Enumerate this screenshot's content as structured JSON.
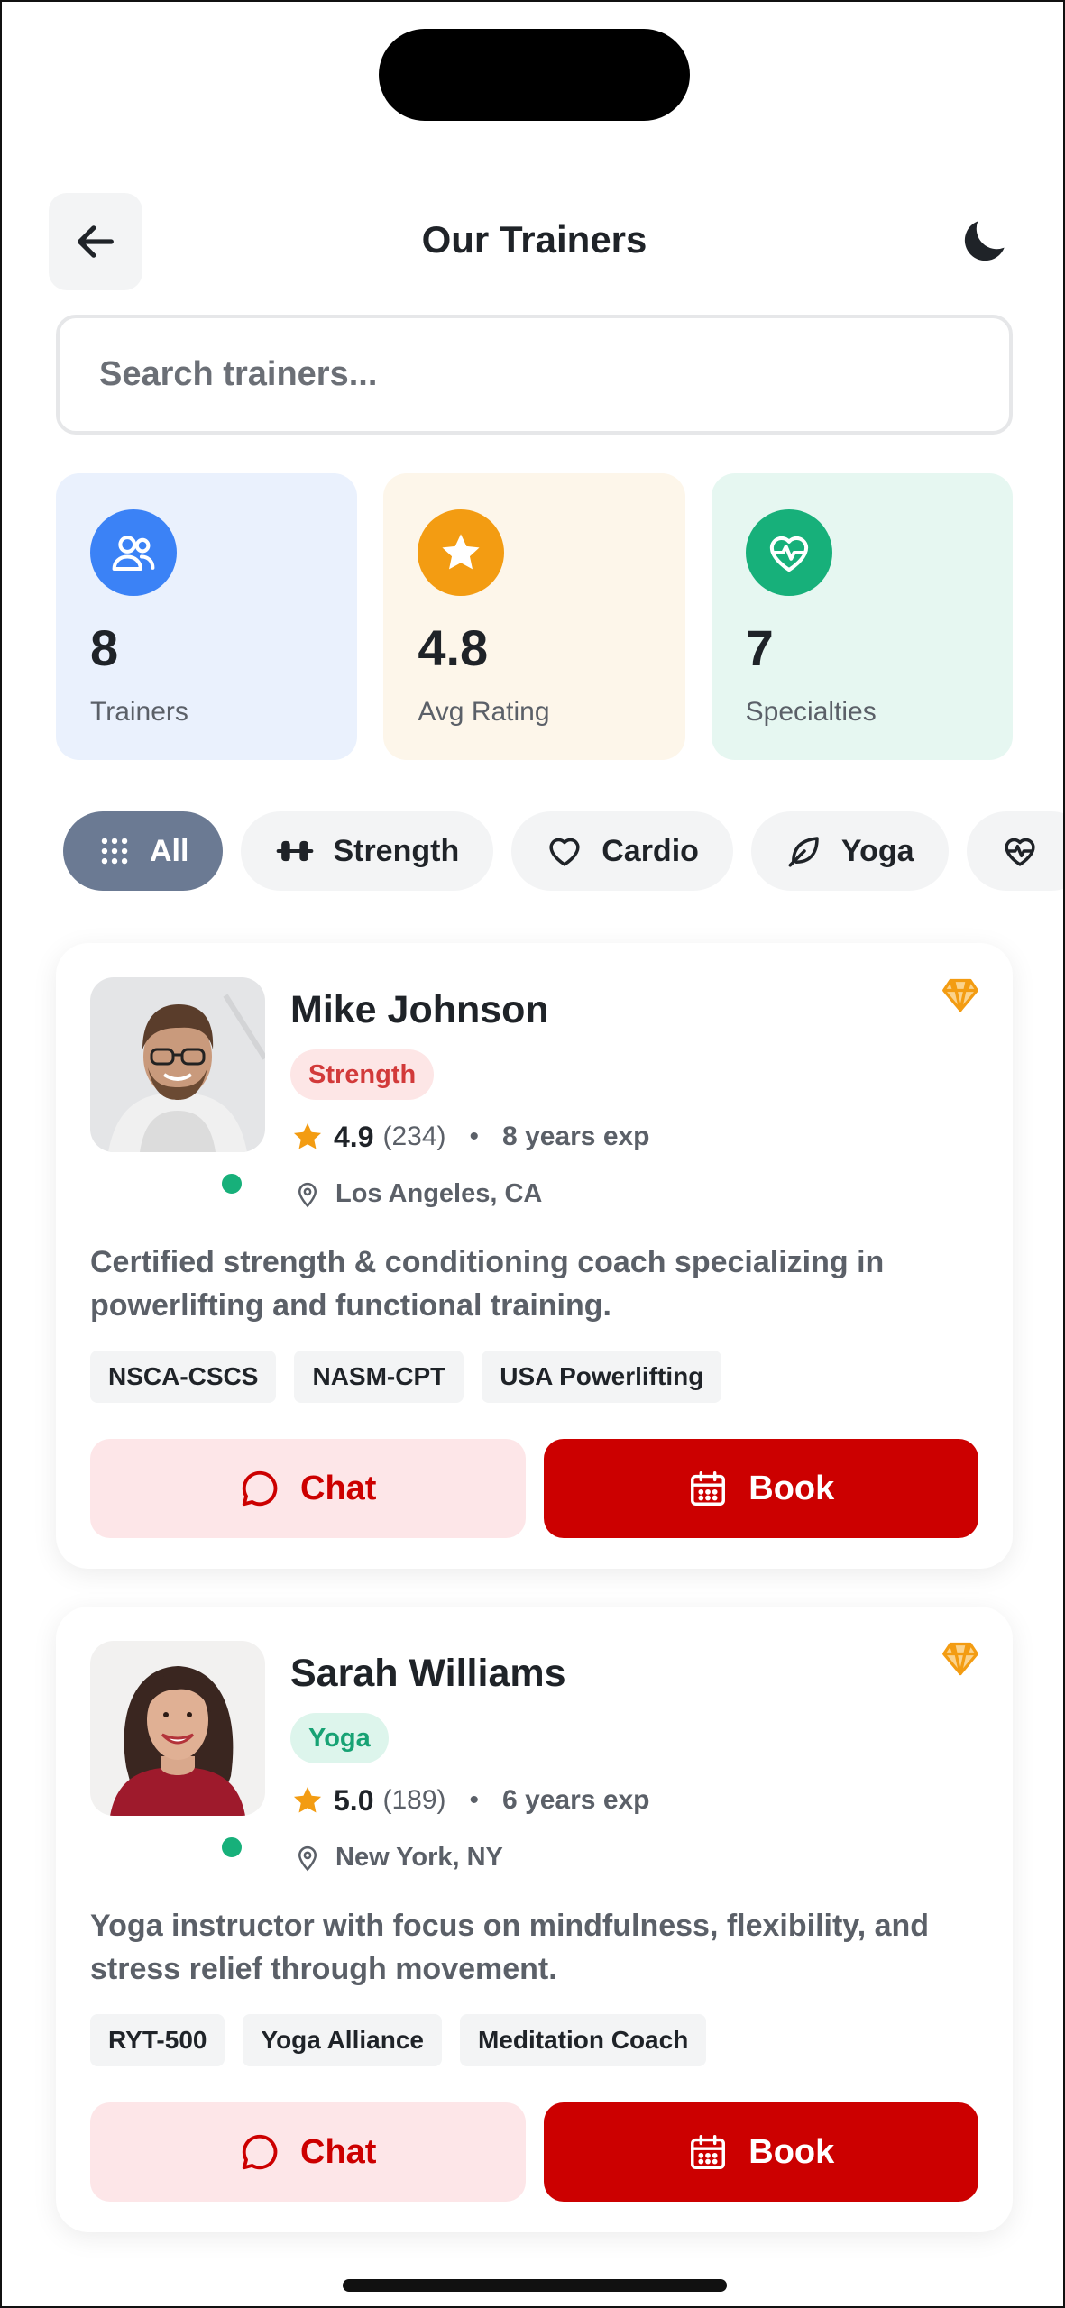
{
  "header": {
    "title": "Our Trainers",
    "back_icon": "arrow-left-icon",
    "theme_icon": "moon-icon"
  },
  "search": {
    "placeholder": "Search trainers...",
    "value": ""
  },
  "stats": [
    {
      "value": "8",
      "label": "Trainers",
      "icon": "users-icon",
      "color": "#3b82f6",
      "bg": "#eaf1fd"
    },
    {
      "value": "4.8",
      "label": "Avg Rating",
      "icon": "star-icon",
      "color": "#f39c12",
      "bg": "#fdf6ea"
    },
    {
      "value": "7",
      "label": "Specialties",
      "icon": "heart-pulse-icon",
      "color": "#17b07a",
      "bg": "#e6f7f1"
    }
  ],
  "filters": [
    {
      "label": "All",
      "icon": "grid-icon",
      "active": true
    },
    {
      "label": "Strength",
      "icon": "dumbbell-icon",
      "active": false
    },
    {
      "label": "Cardio",
      "icon": "heart-icon",
      "active": false
    },
    {
      "label": "Yoga",
      "icon": "leaf-icon",
      "active": false
    },
    {
      "label": "",
      "icon": "heart-pulse-icon",
      "active": false
    }
  ],
  "trainers": [
    {
      "name": "Mike Johnson",
      "specialty": "Strength",
      "rating": "4.9",
      "reviews": "(234)",
      "experience": "8 years exp",
      "location": "Los Angeles, CA",
      "bio": "Certified strength & conditioning coach specializing in powerlifting and functional training.",
      "certifications": [
        "NSCA-CSCS",
        "NASM-CPT",
        "USA Powerlifting"
      ],
      "chat_label": "Chat",
      "book_label": "Book",
      "online": true
    },
    {
      "name": "Sarah Williams",
      "specialty": "Yoga",
      "rating": "5.0",
      "reviews": "(189)",
      "experience": "6 years exp",
      "location": "New York, NY",
      "bio": "Yoga instructor with focus on mindfulness, flexibility, and stress relief through movement.",
      "certifications": [
        "RYT-500",
        "Yoga Alliance",
        "Meditation Coach"
      ],
      "chat_label": "Chat",
      "book_label": "Book",
      "online": true
    }
  ],
  "colors": {
    "accent": "#cc0000",
    "chat_bg": "#fde6e8",
    "active_chip": "#6b7a93",
    "online": "#17b07a",
    "gem": "#f39c12"
  }
}
